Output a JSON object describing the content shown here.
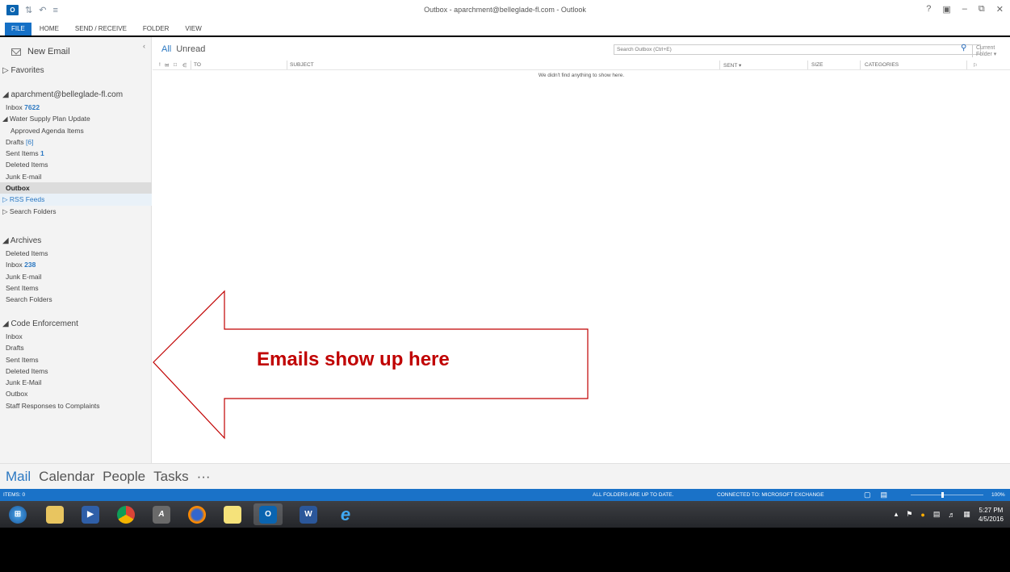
{
  "window": {
    "title": "Outbox - aparchment@belleglade-fl.com - Outlook",
    "controls": [
      "?",
      "❐",
      "–",
      "❐",
      "✕"
    ]
  },
  "ribbon": {
    "tabs": [
      "FILE",
      "HOME",
      "SEND / RECEIVE",
      "FOLDER",
      "VIEW"
    ]
  },
  "nav": {
    "new_email": "New Email",
    "collapse": "‹",
    "favorites": "Favorites",
    "account": {
      "header": "aparchment@belleglade-fl.com",
      "inbox_label": "Inbox",
      "inbox_count": "7622",
      "water_supply": "Water Supply Plan Update",
      "approved_agenda": "Approved Agenda Items",
      "drafts_label": "Drafts",
      "drafts_count": "[6]",
      "sent_label": "Sent Items",
      "sent_count": "1",
      "deleted": "Deleted Items",
      "junk": "Junk E-mail",
      "outbox": "Outbox",
      "rss": "RSS Feeds",
      "search_folders": "Search Folders"
    },
    "archives": {
      "header": "Archives",
      "deleted": "Deleted Items",
      "inbox_label": "Inbox",
      "inbox_count": "238",
      "junk": "Junk E-mail",
      "sent": "Sent Items",
      "search_folders": "Search Folders"
    },
    "code_enforcement": {
      "header": "Code  Enforcement",
      "items": [
        "Inbox",
        "Drafts",
        "Sent Items",
        "Deleted Items",
        "Junk E-Mail",
        "Outbox",
        "Staff Responses to Complaints"
      ]
    }
  },
  "content": {
    "filter_all": "All",
    "filter_unread": "Unread",
    "search_placeholder": "Search Outbox (Ctrl+E)",
    "scope": "Current Folder",
    "columns": {
      "to": "TO",
      "subject": "SUBJECT",
      "sent": "SENT",
      "size": "SIZE",
      "categories": "CATEGORIES"
    },
    "empty_message": "We didn't find anything to show here."
  },
  "annotation": {
    "text": "Emails show up here",
    "color": "#c00000"
  },
  "bottom_nav": {
    "mail": "Mail",
    "calendar": "Calendar",
    "people": "People",
    "tasks": "Tasks",
    "more": "···"
  },
  "statusbar": {
    "items": "ITEMS: 0",
    "sync": "ALL FOLDERS ARE UP TO DATE.",
    "connection": "CONNECTED TO: MICROSOFT EXCHANGE",
    "zoom": "100%"
  },
  "taskbar": {
    "time": "5:27 PM",
    "date": "4/5/2016",
    "apps": [
      "start-orb",
      "file-explorer",
      "media-player",
      "chrome",
      "autocad",
      "firefox",
      "sticky-notes",
      "outlook",
      "word",
      "internet-explorer"
    ]
  },
  "colors": {
    "accent": "#1570c6",
    "link_blue": "#2b78c2",
    "annotation_red": "#c00000"
  }
}
